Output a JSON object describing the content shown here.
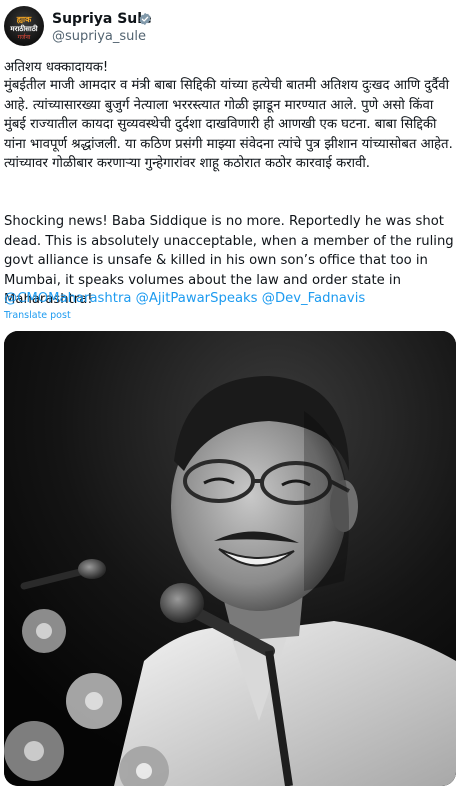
{
  "author": {
    "name": "Supriya Sule",
    "handle": "@supriya_sule",
    "avatar_lines": [
      "ह्याक",
      "मराठीसाठी",
      "गर्जना"
    ],
    "verified_icon": "verified-badge-icon"
  },
  "post": {
    "line1": "अतिशय धक्कादायक!",
    "marathi_paragraph": "मुंबईतील माजी आमदार व मंत्री बाबा सिद्दिकी यांच्या हत्येची बातमी अतिशय दुःखद आणि दुर्दैवी आहे. त्यांच्यासारख्या बुजुर्ग नेत्याला भररस्त्यात गोळी झाडून मारण्यात आले. पुणे असो किंवा मुंबई राज्यातील कायदा सुव्यवस्थेची दुर्दशा दाखविणारी ही आणखी एक घटना. बाबा सिद्दिकी यांना भावपूर्ण श्रद्धांजली. या कठिण प्रसंगी माझ्या संवेदना त्यांचे पुत्र झीशान यांच्यासोबत आहेत. त्यांच्यावर गोळीबार करणाऱ्या गुन्हेगारांवर शाहू कठोरात कठोर कारवाई करावी.",
    "english_paragraph": "Shocking news! Baba Siddique is no more. Reportedly he was shot dead. This is absolutely unacceptable, when a member of the ruling govt alliance is unsafe & killed in his own son’s office that too in Mumbai, it speaks volumes about the law and order state in Maharashtra!",
    "mentions": [
      "@CMOMaharashtra",
      "@AjitPawarSpeaks",
      "@Dev_Fadnavis"
    ],
    "translate_label": "Translate post"
  },
  "colors": {
    "text": "#0f1419",
    "muted": "#536471",
    "link": "#1d9bf0",
    "photo_bg": "#0a0a0a"
  }
}
